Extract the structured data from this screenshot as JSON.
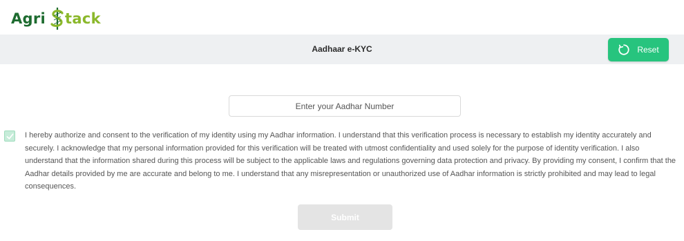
{
  "brand": {
    "logo_part1": "Agri",
    "logo_part2": "tack"
  },
  "header": {
    "title": "Aadhaar e-KYC",
    "reset_label": "Reset"
  },
  "form": {
    "aadhar_placeholder": "Enter your Aadhar Number",
    "aadhar_value": "",
    "consent_checked": true,
    "consent_text": "I hereby authorize and consent to the verification of my identity using my Aadhar information. I understand that this verification process is necessary to establish my identity accurately and securely. I acknowledge that my personal information provided for this verification will be treated with utmost confidentiality and used solely for the purpose of identity verification. I also understand that the information shared during this process will be subject to the applicable laws and regulations governing data protection and privacy. By providing my consent, I confirm that the Aadhar details provided by me are accurate and belong to me. I understand that any misrepresentation or unauthorized use of Aadhar information is strictly prohibited and may lead to legal consequences.",
    "submit_label": "Submit"
  },
  "colors": {
    "accent_green": "#27c47e",
    "logo_dark_green": "#1d6b2f",
    "logo_light_green": "#8bb82b",
    "header_bg": "#eef0f2",
    "submit_disabled_bg": "#e4e4e4"
  },
  "icons": {
    "reset": "refresh-icon",
    "checkbox": "check-icon",
    "logo_s": "dollar-s-icon"
  }
}
